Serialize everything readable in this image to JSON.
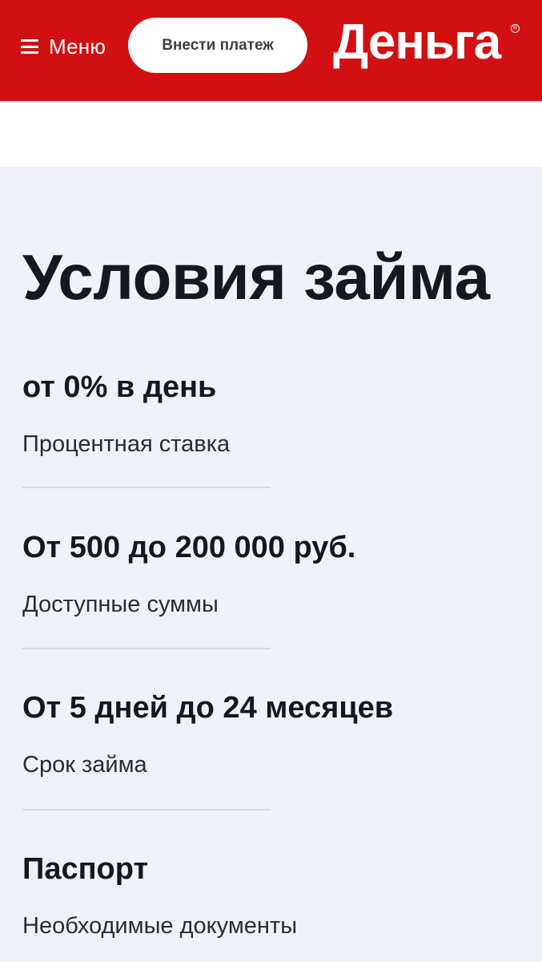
{
  "header": {
    "menu_label": "Меню",
    "pay_button_label": "Внести платеж",
    "logo_text": "Деньга",
    "logo_mark": "R",
    "brand_color": "#d01012"
  },
  "loan_conditions": {
    "title": "Условия займа",
    "items": [
      {
        "value": "от 0% в день",
        "caption": "Процентная ставка"
      },
      {
        "value": "От 500 до 200 000 руб.",
        "caption": "Доступные суммы"
      },
      {
        "value": "От 5 дней до 24 месяцев",
        "caption": "Срок займа"
      },
      {
        "value": "Паспорт",
        "caption": "Необходимые документы"
      }
    ]
  }
}
